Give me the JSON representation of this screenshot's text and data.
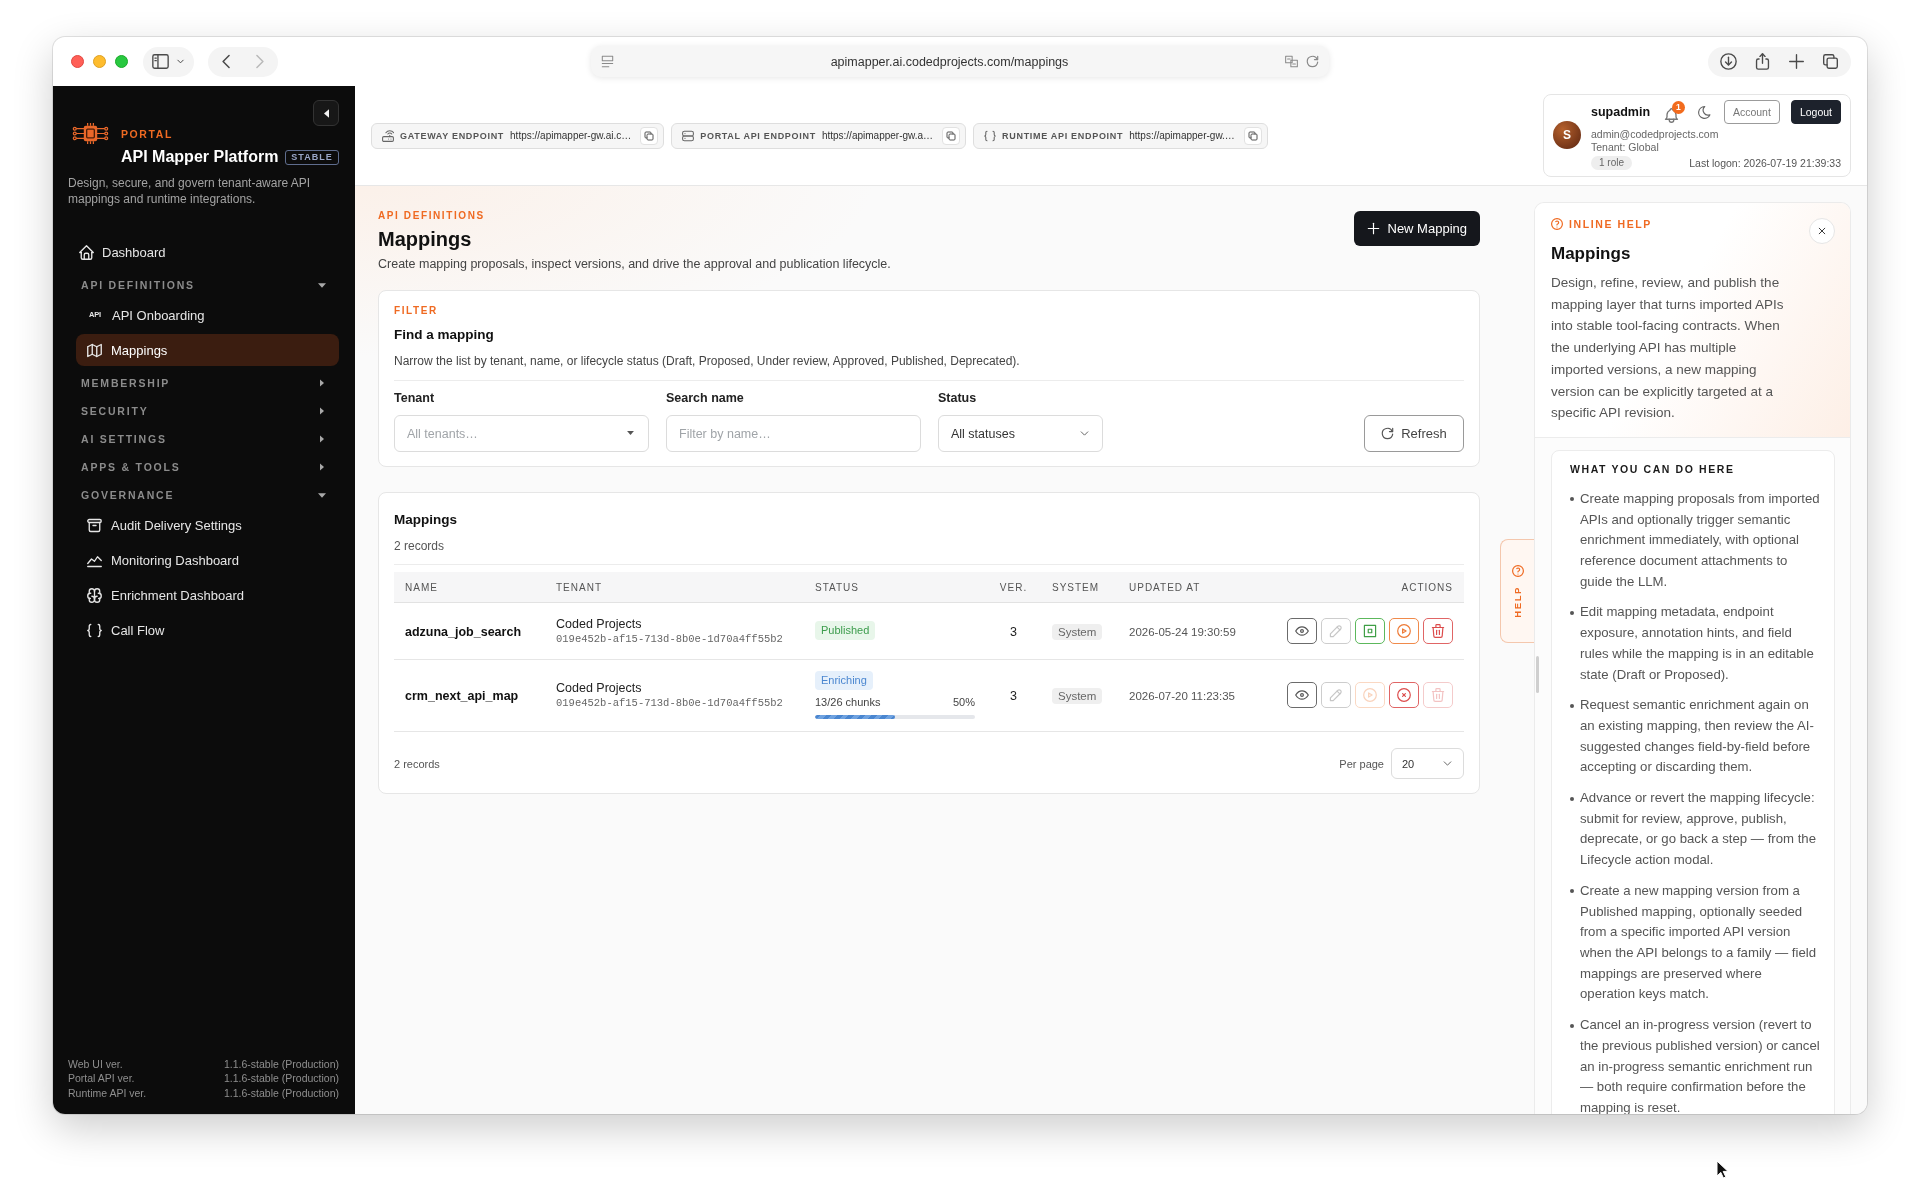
{
  "browser": {
    "url": "apimapper.ai.codedprojects.com/mappings"
  },
  "sidebar": {
    "eyebrow": "PORTAL",
    "title": "API Mapper Platform",
    "badge": "STABLE",
    "description": "Design, secure, and govern tenant-aware API mappings and runtime integrations.",
    "nav": [
      {
        "kind": "link",
        "label": "Dashboard",
        "selected": false
      },
      {
        "kind": "group",
        "label": "API DEFINITIONS",
        "expanded": true,
        "children": [
          {
            "label": "API Onboarding",
            "icon_text": "API",
            "selected": false
          },
          {
            "label": "Mappings",
            "selected": true
          }
        ]
      },
      {
        "kind": "group",
        "label": "MEMBERSHIP",
        "expanded": false
      },
      {
        "kind": "group",
        "label": "SECURITY",
        "expanded": false
      },
      {
        "kind": "group",
        "label": "AI SETTINGS",
        "expanded": false
      },
      {
        "kind": "group",
        "label": "APPS & TOOLS",
        "expanded": false
      },
      {
        "kind": "group",
        "label": "GOVERNANCE",
        "expanded": true,
        "children": [
          {
            "label": "Audit Delivery Settings",
            "selected": false
          },
          {
            "label": "Monitoring Dashboard",
            "selected": false
          },
          {
            "label": "Enrichment Dashboard",
            "selected": false
          },
          {
            "label": "Call Flow",
            "selected": false
          }
        ]
      }
    ],
    "versions": [
      {
        "label": "Web UI ver.",
        "value": "1.1.6-stable (Production)"
      },
      {
        "label": "Portal API ver.",
        "value": "1.1.6-stable (Production)"
      },
      {
        "label": "Runtime API ver.",
        "value": "1.1.6-stable (Production)"
      }
    ]
  },
  "topbar": {
    "endpoints": [
      {
        "label": "GATEWAY ENDPOINT",
        "url": "https://apimapper-gw.ai.c…"
      },
      {
        "label": "PORTAL API ENDPOINT",
        "url": "https://apimapper-gw.a…"
      },
      {
        "label": "RUNTIME API ENDPOINT",
        "url": "https://apimapper-gw.…"
      }
    ],
    "user": {
      "initial": "S",
      "name": "supadmin",
      "notifications": "1",
      "email": "admin@codedprojects.com",
      "tenant": "Tenant: Global",
      "roles": "1 role",
      "last_logon": "Last logon: 2026-07-19 21:39:33",
      "buttons": [
        {
          "kind": "outline",
          "label": "Account"
        },
        {
          "kind": "solid",
          "label": "Logout"
        }
      ]
    }
  },
  "page": {
    "eyebrow": "API DEFINITIONS",
    "title": "Mappings",
    "subtitle": "Create mapping proposals, inspect versions, and drive the approval and publication lifecycle.",
    "new_button": "New Mapping"
  },
  "filter": {
    "eyebrow": "FILTER",
    "title": "Find a mapping",
    "description": "Narrow the list by tenant, name, or lifecycle status (Draft, Proposed, Under review, Approved, Published, Deprecated).",
    "fields": [
      {
        "kind": "combobox",
        "label": "Tenant",
        "placeholder": "All tenants…"
      },
      {
        "kind": "text",
        "label": "Search name",
        "placeholder": "Filter by name…"
      },
      {
        "kind": "select",
        "label": "Status",
        "value": "All statuses"
      }
    ],
    "refresh_button": "Refresh"
  },
  "table": {
    "title": "Mappings",
    "count": "2 records",
    "columns": [
      "NAME",
      "TENANT",
      "STATUS",
      "VER.",
      "SYSTEM",
      "UPDATED AT",
      "ACTIONS"
    ],
    "rows": [
      {
        "name": "adzuna_job_search",
        "tenant": "Coded Projects",
        "tenant_id": "019e452b-af15-713d-8b0e-1d70a4ff55b2",
        "status": {
          "kind": "published",
          "label": "Published"
        },
        "version": "3",
        "system": "System",
        "updated_at": "2026-05-24 19:30:59",
        "actions": [
          {
            "kind": "view",
            "disabled": false
          },
          {
            "kind": "edit",
            "disabled": true
          },
          {
            "kind": "stop",
            "disabled": false
          },
          {
            "kind": "run",
            "disabled": false
          },
          {
            "kind": "delete",
            "disabled": false
          }
        ]
      },
      {
        "name": "crm_next_api_map",
        "tenant": "Coded Projects",
        "tenant_id": "019e452b-af15-713d-8b0e-1d70a4ff55b2",
        "status": {
          "kind": "enriching",
          "label": "Enriching",
          "progress": "13/26 chunks",
          "percent": "50%",
          "level": 0.5
        },
        "version": "3",
        "system": "System",
        "updated_at": "2026-07-20 11:23:35",
        "actions": [
          {
            "kind": "view",
            "disabled": false
          },
          {
            "kind": "edit",
            "disabled": true
          },
          {
            "kind": "run",
            "disabled": true
          },
          {
            "kind": "cancel",
            "disabled": false
          },
          {
            "kind": "delete",
            "disabled": true
          }
        ]
      }
    ],
    "footer_count": "2 records",
    "per_page_label": "Per page",
    "per_page": "20"
  },
  "help": {
    "tab_label": "HELP",
    "eyebrow": "INLINE HELP",
    "title": "Mappings",
    "intro": "Design, refine, review, and publish the mapping layer that turns imported APIs into stable tool-facing contracts. When the underlying API has multiple imported versions, a new mapping version can be explicitly targeted at a specific API revision.",
    "section_title": "WHAT YOU CAN DO HERE",
    "items": [
      "Create mapping proposals from imported APIs and optionally trigger semantic enrichment immediately, with optional reference document attachments to guide the LLM.",
      "Edit mapping metadata, endpoint exposure, annotation hints, and field rules while the mapping is in an editable state (Draft or Proposed).",
      "Request semantic enrichment again on an existing mapping, then review the AI-suggested changes field-by-field before accepting or discarding them.",
      "Advance or revert the mapping lifecycle: submit for review, approve, publish, deprecate, or go back a step — from the Lifecycle action modal.",
      "Create a new mapping version from a Published mapping, optionally seeded from a specific imported API version when the API belongs to a family — field mappings are preserved where operation keys match.",
      "Cancel an in-progress version (revert to the previous published version) or cancel an in-progress semantic enrichment run — both require confirmation before the mapping is reset."
    ]
  }
}
